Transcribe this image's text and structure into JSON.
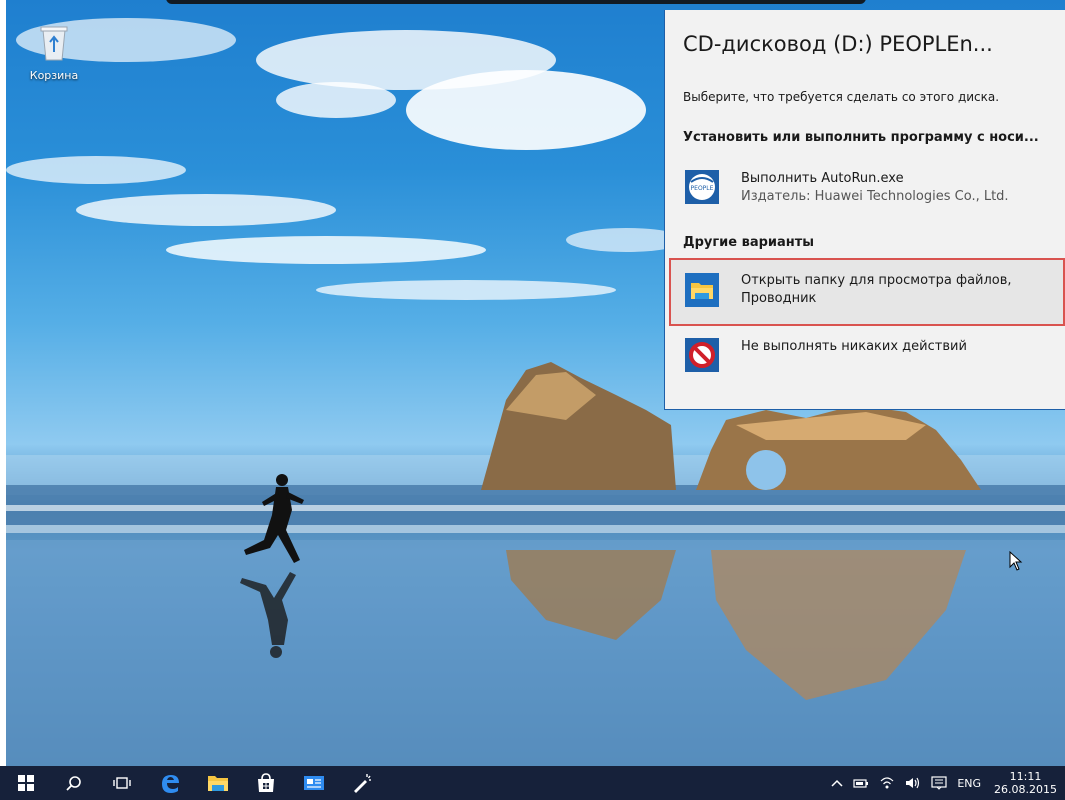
{
  "desktop": {
    "recycle_bin_label": "Корзина"
  },
  "autoplay": {
    "title": "CD-дисковод (D:) PEOPLEn...",
    "prompt": "Выберите, что требуется сделать со этого диска.",
    "section_install": "Установить или выполнить программу с носи...",
    "section_other": "Другие варианты",
    "options": [
      {
        "icon": "peoplenet-app-icon",
        "label": "Выполнить AutoRun.exe",
        "sublabel": "Издатель: Huawei Technologies Co., Ltd.",
        "icon_text": "PEOPLE"
      },
      {
        "icon": "file-explorer-folder-icon",
        "label": "Открыть папку для просмотра файлов,",
        "sublabel": "Проводник",
        "highlighted": true
      },
      {
        "icon": "no-action-icon",
        "label": "Не выполнять никаких действий"
      }
    ],
    "accent_color": "#1e5fa8",
    "highlight_border_color": "#d9534f"
  },
  "taskbar": {
    "items": [
      {
        "name": "start-button",
        "icon": "windows-logo-icon"
      },
      {
        "name": "search-button",
        "icon": "search-icon"
      },
      {
        "name": "task-view-button",
        "icon": "task-view-icon"
      },
      {
        "name": "edge-button",
        "icon": "edge-icon"
      },
      {
        "name": "file-explorer-button",
        "icon": "folder-icon"
      },
      {
        "name": "store-button",
        "icon": "store-icon"
      },
      {
        "name": "mail-button",
        "icon": "mail-icon"
      },
      {
        "name": "app-button",
        "icon": "pen-icon"
      }
    ],
    "tray": {
      "language": "ENG",
      "time": "11:11",
      "date": "26.08.2015"
    },
    "background_color": "#16213a"
  }
}
